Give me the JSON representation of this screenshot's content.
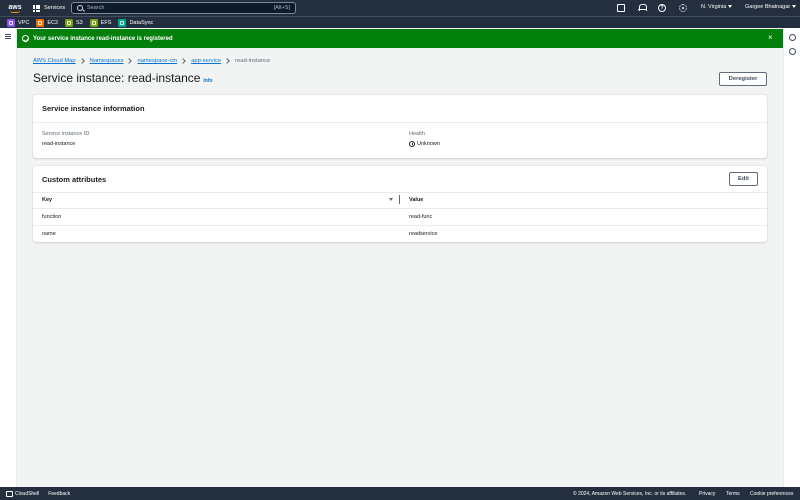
{
  "topnav": {
    "logo": "aws",
    "services_label": "Services",
    "search_placeholder": "Search",
    "search_shortcut": "[Alt+S]",
    "region": "N. Virginia",
    "user": "Gargee Bhatnagar",
    "help_glyph": "?",
    "icons": [
      "cloudshell-icon",
      "bell-icon",
      "help-icon",
      "gear-icon"
    ]
  },
  "favorites": [
    {
      "label": "VPC",
      "color": "#8c4fff"
    },
    {
      "label": "EC2",
      "color": "#ed7100"
    },
    {
      "label": "S3",
      "color": "#7aa116"
    },
    {
      "label": "EFS",
      "color": "#7aa116"
    },
    {
      "label": "DataSync",
      "color": "#01a88d"
    }
  ],
  "flash": {
    "message": "Your service instance read-instance is registered",
    "close": "×",
    "color": "#037f0c"
  },
  "breadcrumb": [
    "AWS Cloud Map",
    "Namespaces",
    "namespace-cm",
    "app-service",
    "read-instance"
  ],
  "page": {
    "title": "Service instance: read-instance",
    "info_link": "Info",
    "deregister_label": "Deregister"
  },
  "instance_info": {
    "heading": "Service instance information",
    "id_label": "Service instance ID",
    "id_value": "read-instance",
    "health_label": "Health",
    "health_value": "Unknown"
  },
  "custom_attributes": {
    "heading": "Custom attributes",
    "edit_label": "Edit",
    "columns": [
      "Key",
      "Value"
    ],
    "rows": [
      {
        "key": "function",
        "value": "read-func"
      },
      {
        "key": "name",
        "value": "readservice"
      }
    ]
  },
  "footer": {
    "cloudshell": "CloudShell",
    "feedback": "Feedback",
    "copyright": "© 2024, Amazon Web Services, Inc. or its affiliates.",
    "privacy": "Privacy",
    "terms": "Terms",
    "cookies": "Cookie preferences"
  }
}
